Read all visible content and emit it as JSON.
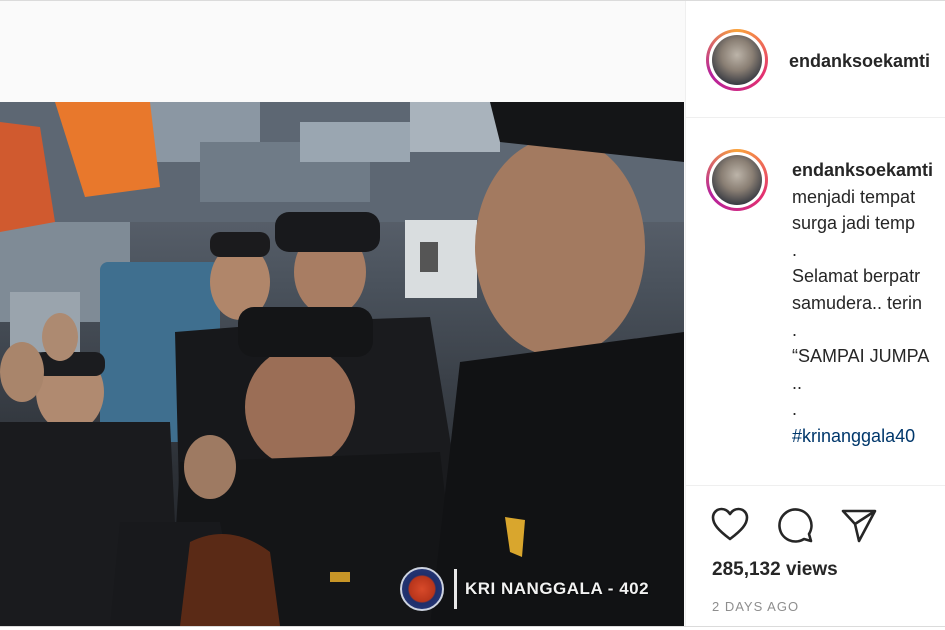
{
  "post": {
    "username": "endanksoekamti",
    "caption_lines": [
      "menjadi tempat",
      "surga jadi temp",
      ".",
      "Selamat berpatr",
      "samudera.. terin",
      ".",
      "“SAMPAI JUMPA",
      "..",
      "."
    ],
    "hashtag": "#krinanggala40",
    "views": "285,132 views",
    "time_ago": "2 DAYS AGO"
  },
  "video": {
    "watermark_text": "KRI NANGGALA - 402"
  },
  "icons": {
    "like": "heart-icon",
    "comment": "comment-icon",
    "share": "paper-plane-icon"
  },
  "colors": {
    "hashtag": "#00376b",
    "timestamp": "#8e8e8e",
    "avatar_ring": "#e33070"
  }
}
